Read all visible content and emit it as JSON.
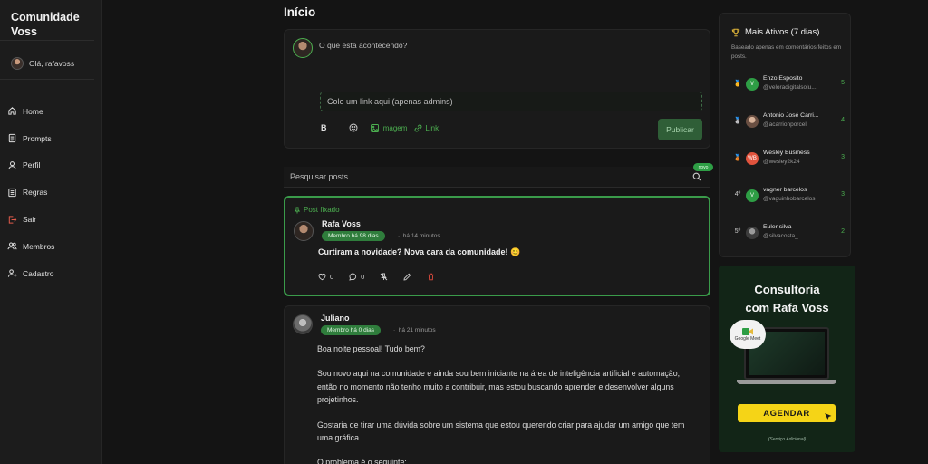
{
  "sidebar": {
    "brand": "Comunidade Voss",
    "greeting": "Olá, rafavoss",
    "items": [
      {
        "label": "Home",
        "icon": "home-icon"
      },
      {
        "label": "Prompts",
        "icon": "document-icon"
      },
      {
        "label": "Perfil",
        "icon": "user-icon"
      },
      {
        "label": "Regras",
        "icon": "rules-icon"
      },
      {
        "label": "Sair",
        "icon": "logout-icon"
      },
      {
        "label": "Membros",
        "icon": "users-icon"
      },
      {
        "label": "Cadastro",
        "icon": "user-add-icon"
      }
    ]
  },
  "main": {
    "title": "Início",
    "composer": {
      "placeholder": "O que está acontecendo?",
      "link_placeholder": "Cole um link aqui (apenas admins)",
      "bold_label": "B",
      "image_label": "Imagem",
      "link_label": "Link",
      "publish_label": "Publicar"
    },
    "search": {
      "placeholder": "Pesquisar posts...",
      "badge": "novo"
    },
    "pinned_post": {
      "pinned_label": "Post fixado",
      "author": "Rafa Voss",
      "member_badge": "Membro há 98 dias",
      "time": "há 14 minutos",
      "text": "Curtiram a novidade? Nova cara da comunidade! 😊",
      "likes": "0",
      "comments": "0"
    },
    "post2": {
      "author": "Juliano",
      "member_badge": "Membro há 0 dias",
      "time": "há 21 minutos",
      "paragraphs": [
        "Boa noite pessoal! Tudo bem?",
        "Sou novo aqui na comunidade e ainda sou bem iniciante na área de inteligência artificial e automação, então no momento não tenho muito a contribuir, mas estou buscando aprender e desenvolver alguns projetinhos.",
        "Gostaria de tirar uma dúvida sobre um sistema que estou querendo criar para ajudar um amigo que tem uma gráfica.",
        "O problema é o seguinte:"
      ]
    }
  },
  "ranking": {
    "title": "Mais Ativos (7 dias)",
    "subtitle": "Baseado apenas em comentários feitos em posts.",
    "rows": [
      {
        "pos": "🥇",
        "initials": "V",
        "color": "#2e9e45",
        "name": "Enzo Esposito",
        "handle": "@veloradigitalsolu...",
        "count": "5"
      },
      {
        "pos": "🥈",
        "initials": "",
        "color": "#8a6a5a",
        "name": "Antonio José Carri...",
        "handle": "@acarrionporcel",
        "count": "4"
      },
      {
        "pos": "🥉",
        "initials": "WB",
        "color": "#e0533d",
        "name": "Wesley Business",
        "handle": "@wesley2k24",
        "count": "3"
      },
      {
        "pos": "4º",
        "initials": "V",
        "color": "#2e9e45",
        "name": "vagner barcelos",
        "handle": "@vaguinhobarcelos",
        "count": "3"
      },
      {
        "pos": "5º",
        "initials": "",
        "color": "#5a5a5a",
        "name": "Euler silva",
        "handle": "@silvacosta_",
        "count": "2"
      }
    ]
  },
  "promo": {
    "title_line1": "Consultoria",
    "title_line2": "com Rafa Voss",
    "meet_label": "Google Meet",
    "cta": "AGENDAR",
    "footer": "(Serviço Adicional)"
  }
}
